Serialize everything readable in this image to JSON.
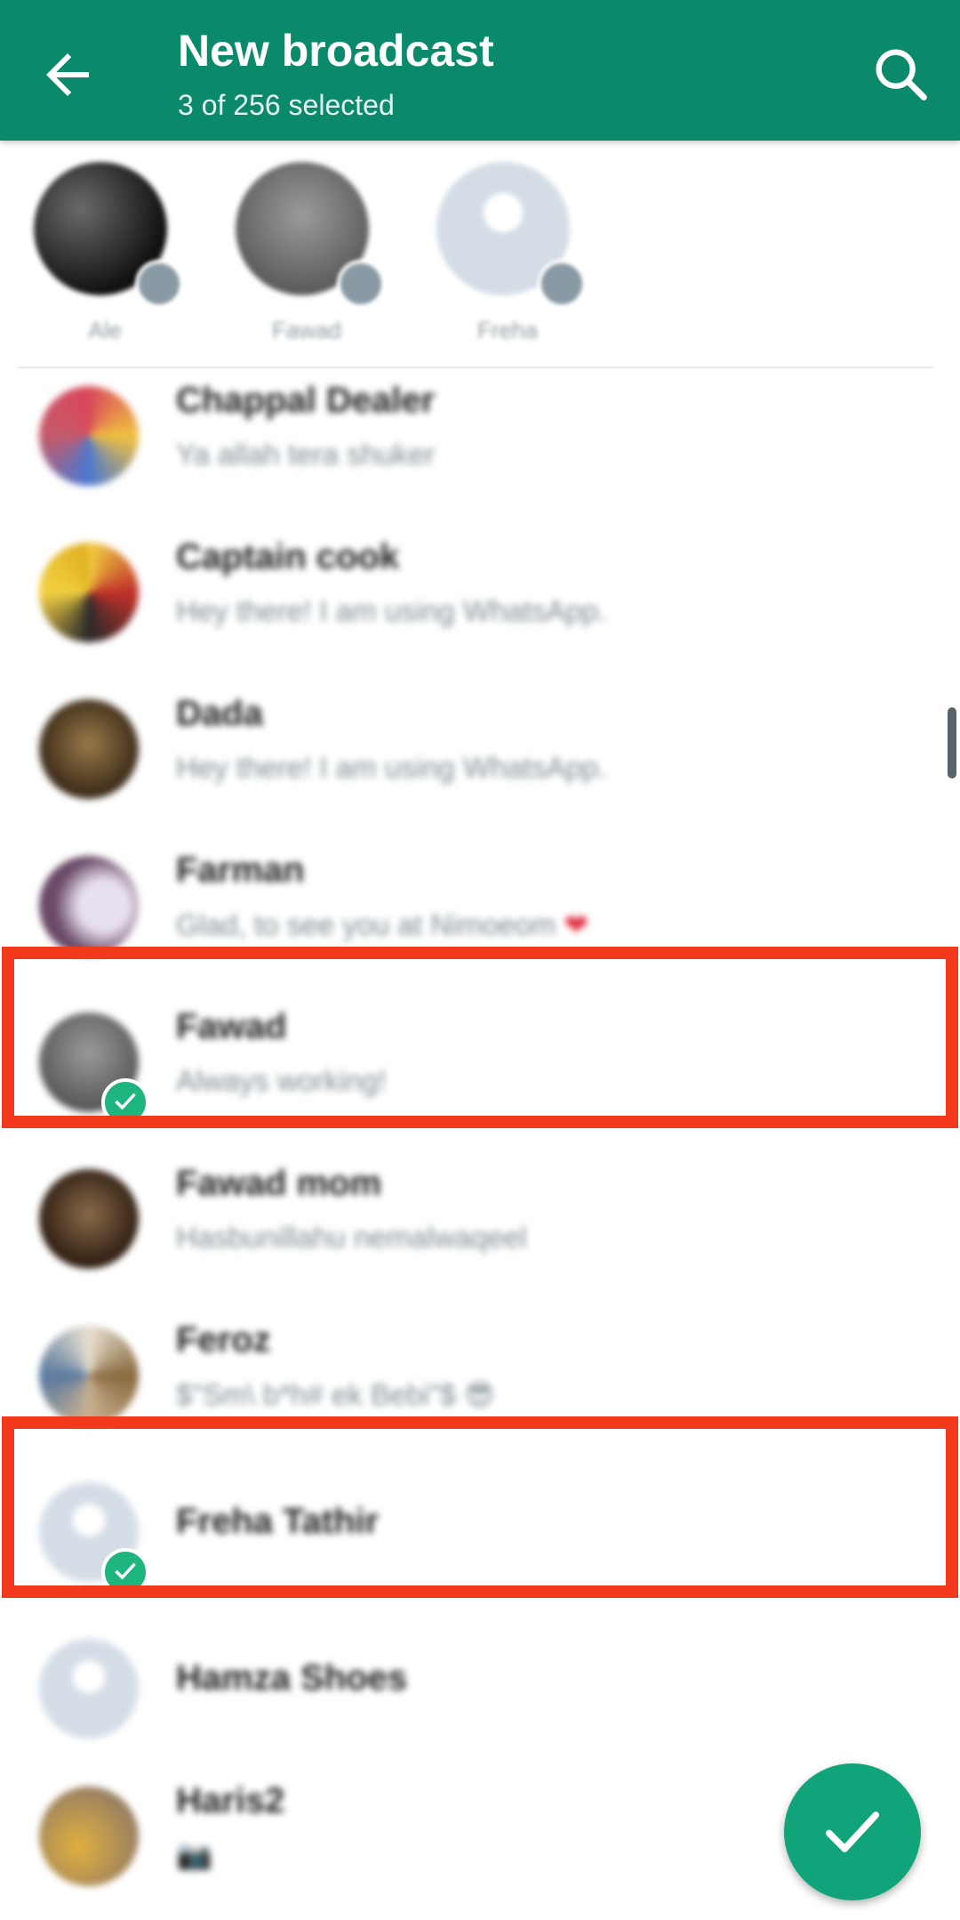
{
  "header": {
    "title": "New broadcast",
    "subtitle": "3 of 256 selected",
    "back_icon": "arrow-back-icon",
    "search_icon": "search-icon",
    "background_color": "#0a8a6b"
  },
  "selected": [
    {
      "name": "Ale",
      "avatar_color": "#2a2a2a"
    },
    {
      "name": "Fawad",
      "avatar_color": "#808080"
    },
    {
      "name": "Freha",
      "avatar_color": "#d4dde6"
    }
  ],
  "contacts": [
    {
      "name": "Chappal Dealer",
      "status": "Ya allah tera shuker",
      "avatar_color": "#c45a6a",
      "selected": false
    },
    {
      "name": "Captain cook",
      "status": "Hey there! I am using WhatsApp.",
      "avatar_color": "#d4a21e",
      "selected": false
    },
    {
      "name": "Dada",
      "status": "Hey there! I am using WhatsApp.",
      "avatar_color": "#4a3a28",
      "selected": false
    },
    {
      "name": "Farman",
      "status": "Glad, to see you at Nimoeom",
      "status_emoji": "❤",
      "avatar_color": "#7a5a78",
      "selected": false
    },
    {
      "name": "Fawad",
      "status": "Always working!",
      "avatar_color": "#7a7a7a",
      "selected": true
    },
    {
      "name": "Fawad mom",
      "status": "Hasbunillahu nemalwaqeel",
      "avatar_color": "#4b3524",
      "selected": false
    },
    {
      "name": "Feroz",
      "status": "$\"Sm\\ b*h# ek Bebi\"$",
      "status_emoji": "😎",
      "avatar_color": "#a8906a",
      "selected": false
    },
    {
      "name": "Freha Tathir",
      "status": "",
      "avatar_color": "#d4dde6",
      "selected": true
    },
    {
      "name": "Hamza Shoes",
      "status": "",
      "avatar_color": "#d4dde6",
      "selected": false
    },
    {
      "name": "Haris2",
      "status": "📷",
      "avatar_color": "#c8a050",
      "selected": false
    }
  ],
  "fab": {
    "icon": "check-icon",
    "color": "#11a47a"
  },
  "highlight_color": "#f2391c"
}
